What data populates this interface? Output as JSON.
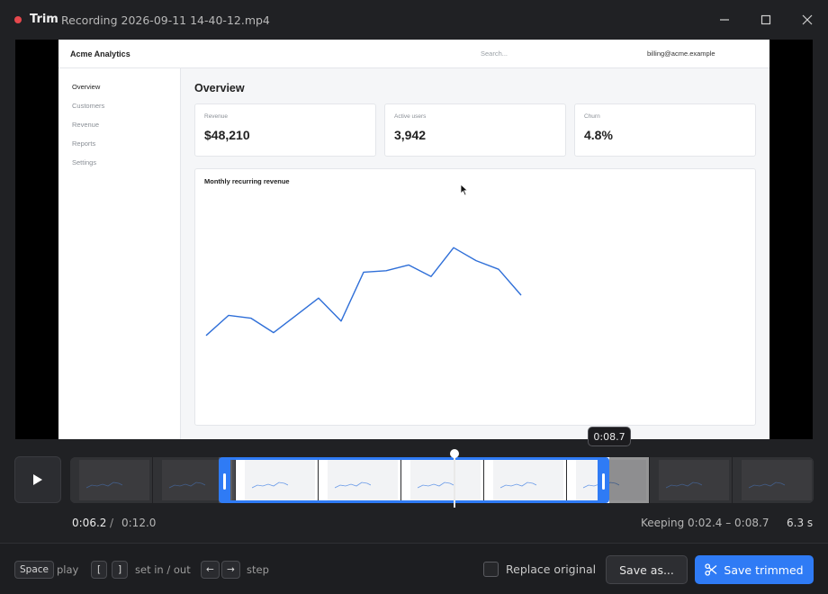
{
  "window": {
    "app_name": "Trim",
    "file_name": "Recording 2026-09-11 14-40-12.mp4",
    "record_color": "#e5484d"
  },
  "recording": {
    "brand": "Acme Analytics",
    "search_placeholder": "Search...",
    "user_email": "billing@acme.example",
    "nav": [
      "Overview",
      "Customers",
      "Revenue",
      "Reports",
      "Settings"
    ],
    "active_nav": "Overview",
    "page_title": "Overview",
    "cards": [
      {
        "label": "Revenue",
        "value": "$48,210"
      },
      {
        "label": "Active users",
        "value": "3,942"
      },
      {
        "label": "Churn",
        "value": "4.8%"
      }
    ],
    "chart_title": "Monthly recurring revenue",
    "chart_data": {
      "type": "line",
      "title": "Monthly recurring revenue",
      "values": [
        22,
        36,
        34,
        24,
        36,
        48,
        32,
        66,
        67,
        71,
        63,
        83,
        74,
        68,
        50
      ],
      "ylim": [
        0,
        100
      ],
      "color": "#2f6fd8"
    }
  },
  "playback": {
    "current_time": "0:06.2",
    "separator": "/",
    "total_time": "0:12.0",
    "playhead_tooltip": "0:08.7",
    "playhead_fraction": 0.517,
    "in_fraction": 0.2,
    "out_fraction": 0.725
  },
  "selection": {
    "keeping": "Keeping 0:02.4 – 0:08.7",
    "duration": "6.3 s",
    "accent_color": "#2f7bf5"
  },
  "shortcuts": [
    {
      "keys": [
        "Space"
      ],
      "label": "play"
    },
    {
      "keys": [
        "[",
        "]"
      ],
      "label": "set in / out"
    },
    {
      "keys": [
        "←",
        "→"
      ],
      "label": "step"
    }
  ],
  "footer": {
    "replace_original_label": "Replace original",
    "replace_original_checked": false,
    "save_as_label": "Save as...",
    "save_trimmed_label": "Save trimmed"
  }
}
